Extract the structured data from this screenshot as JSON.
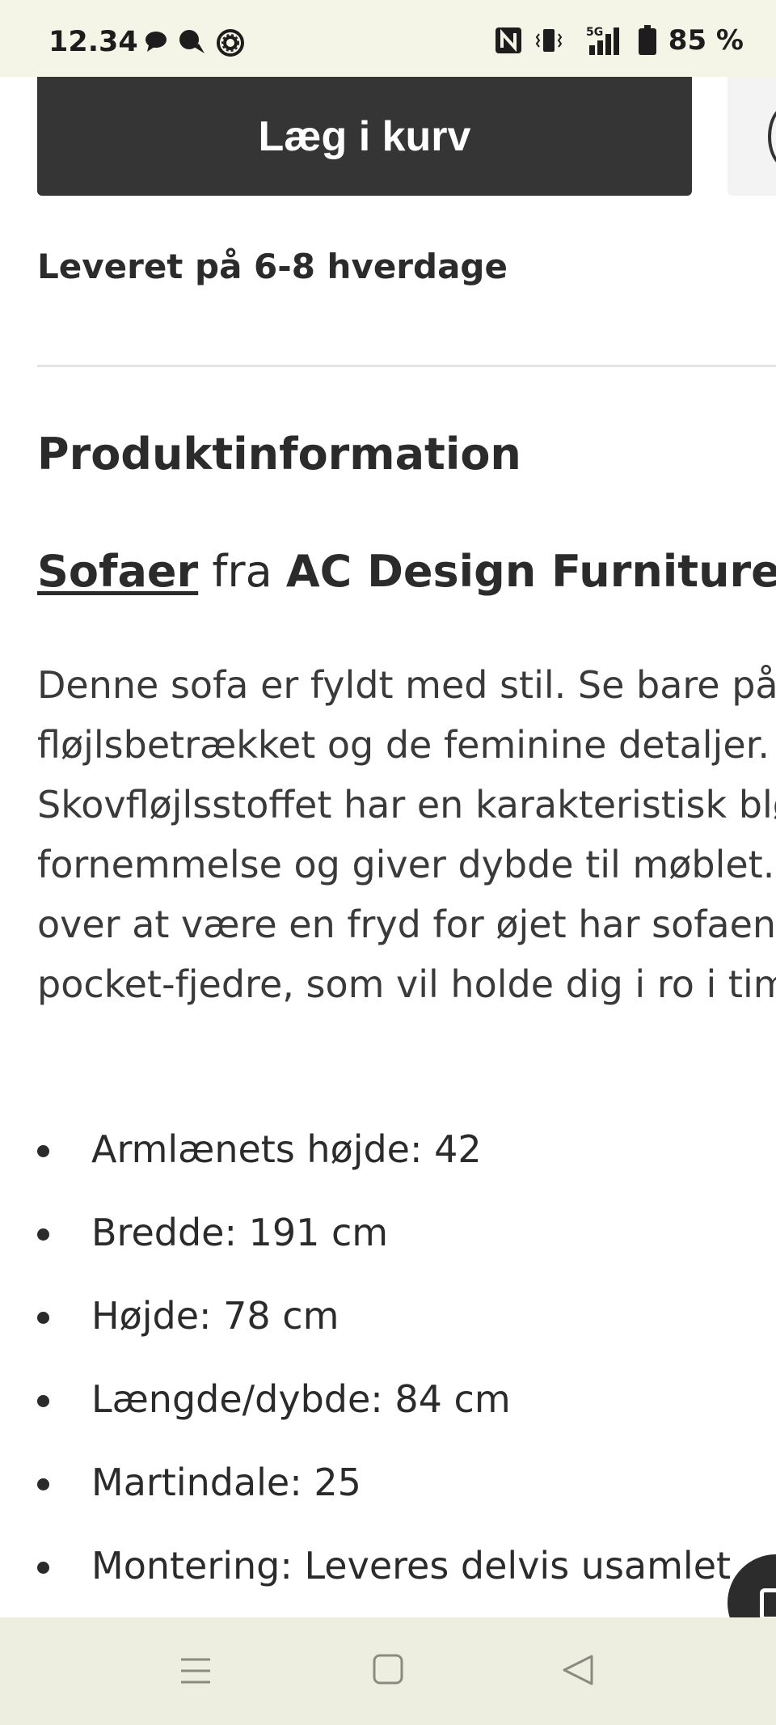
{
  "status_bar": {
    "time": "12.34",
    "battery": "85 %",
    "network": "5G",
    "left_icons": [
      "chat-bubble-icon",
      "speech-bubble-icon",
      "settings-circle-icon"
    ],
    "right_icons": [
      "nfc-icon",
      "vibrate-icon",
      "signal-5g-icon",
      "battery-icon"
    ]
  },
  "product": {
    "add_to_cart_label": "Læg i kurv",
    "delivery_text": "Leveret på 6-8 hverdage"
  },
  "info": {
    "section_title": "Produktinformation",
    "category_link": "Sofaer",
    "from_text": "fra",
    "brand": "AC Design Furniture",
    "description_lines": [
      "Denne sofa er fyldt med stil. Se bare på",
      "fløjlsbetrækket og de feminine detaljer.",
      "Skovfløjlsstoffet har en karakteristisk blød",
      "fornemmelse og giver dybde til møblet.",
      "over at være en fryd for øjet har sofaen",
      "pocket-fjedre, som vil holde dig i ro i tim"
    ],
    "specs": [
      "Armlænets højde: 42",
      "Bredde: 191 cm",
      "Højde: 78 cm",
      "Længde/dybde: 84 cm",
      "Martindale: 25",
      "Montering: Leveres delvis usamlet"
    ]
  },
  "nav_bar": {
    "icons": [
      "menu-icon",
      "home-icon",
      "back-icon"
    ]
  },
  "colors": {
    "button_bg": "#353535",
    "status_bar_bg": "#f4f5e6",
    "nav_bar_bg": "#eeeee0",
    "text": "#2b2b2b"
  }
}
